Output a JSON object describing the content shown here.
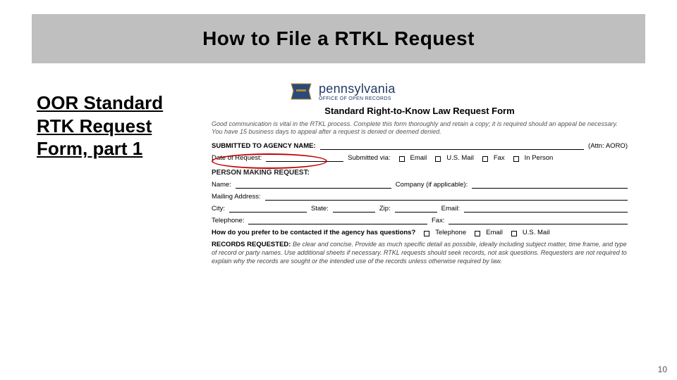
{
  "slide": {
    "title": "How to File a RTKL Request",
    "caption_l1": "OOR Standard",
    "caption_l2": "RTK Request",
    "caption_l3": "Form, part 1",
    "page_number": "10"
  },
  "form": {
    "brand_name": "pennsylvania",
    "brand_sub": "OFFICE OF OPEN RECORDS",
    "title": "Standard Right-to-Know Law Request Form",
    "intro": "Good communication is vital in the RTKL process. Complete this form thoroughly and retain a copy; it is required should an appeal be necessary. You have 15 business days to appeal after a request is denied or deemed denied.",
    "submitted_to": "SUBMITTED TO AGENCY NAME:",
    "attn": "(Attn: AORO)",
    "date_label": "Date of Request:",
    "submitted_via": "Submitted via:",
    "via_email": "Email",
    "via_mail": "U.S. Mail",
    "via_fax": "Fax",
    "via_person": "In Person",
    "person_heading": "PERSON MAKING REQUEST:",
    "name": "Name:",
    "company": "Company (if applicable):",
    "mailing": "Mailing Address:",
    "city": "City:",
    "state": "State:",
    "zip": "Zip:",
    "email": "Email:",
    "telephone": "Telephone:",
    "fax": "Fax:",
    "contact_pref": "How do you prefer to be contacted if the agency has questions?",
    "pref_tel": "Telephone",
    "pref_email": "Email",
    "pref_mail": "U.S. Mail",
    "records_heading": "RECORDS REQUESTED:",
    "records_text": "Be clear and concise. Provide as much specific detail as possible, ideally including subject matter, time frame, and type of record or party names. Use additional sheets if necessary. RTKL requests should seek records, not ask questions. Requesters are not required to explain why the records are sought or the intended use of the records unless otherwise required by law."
  }
}
